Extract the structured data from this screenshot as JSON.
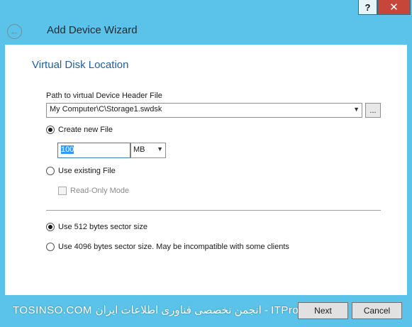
{
  "window": {
    "help_label": "?",
    "close_label": "✕"
  },
  "header": {
    "title": "Add Device Wizard",
    "back_icon": "back-arrow-icon"
  },
  "page": {
    "heading": "Virtual Disk Location",
    "path_label": "Path to virtual Device Header File",
    "path_value": "My Computer\\C\\Storage1.swdsk",
    "browse_label": "...",
    "create_new_label": "Create new File",
    "create_new_checked": true,
    "size_value": "100",
    "size_unit": "MB",
    "use_existing_label": "Use existing File",
    "use_existing_checked": false,
    "read_only_label": "Read-Only Mode",
    "read_only_checked": false,
    "sector_512_label": "Use 512 bytes sector size",
    "sector_512_checked": true,
    "sector_4096_label": "Use 4096 bytes sector size. May be incompatible with some clients",
    "sector_4096_checked": false
  },
  "footer": {
    "watermark": "TOSINSO.COM انجمن تخصصی فناوری اطلاعات ایران - ITPro.ir",
    "next_label": "Next",
    "cancel_label": "Cancel"
  },
  "colors": {
    "frame": "#5bc3e9",
    "heading": "#1f5fa0",
    "close": "#c7463a"
  }
}
